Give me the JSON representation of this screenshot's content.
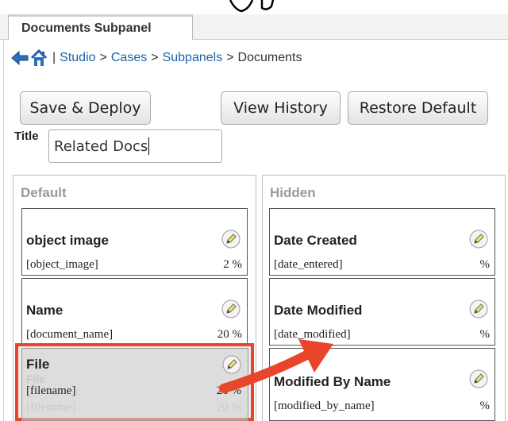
{
  "tab": {
    "label": "Documents Subpanel"
  },
  "breadcrumb": {
    "separator": "|",
    "items": [
      "Studio",
      "Cases",
      "Subpanels"
    ],
    "current": "Documents",
    "gt": ">"
  },
  "buttons": {
    "save_deploy": "Save & Deploy",
    "view_history": "View History",
    "restore_default": "Restore Default"
  },
  "title_field": {
    "label": "Title",
    "value": "Related Docs"
  },
  "columns": {
    "default": {
      "heading": "Default",
      "fields": [
        {
          "name": "object image",
          "key": "[object_image]",
          "width": "2 %"
        },
        {
          "name": "Name",
          "key": "[document_name]",
          "width": "20 %"
        },
        {
          "name": "File",
          "key": "[filename]",
          "width": "20 %"
        }
      ]
    },
    "hidden": {
      "heading": "Hidden",
      "fields": [
        {
          "name": "Date Created",
          "key": "[date_entered]",
          "width": "%"
        },
        {
          "name": "Date Modified",
          "key": "[date_modified]",
          "width": "%"
        },
        {
          "name": "Modified By Name",
          "key": "[modified_by_name]",
          "width": "%"
        }
      ]
    }
  },
  "colors": {
    "link": "#1f62a6",
    "highlight": "#e8452a",
    "pencil": "#f2e55a"
  }
}
